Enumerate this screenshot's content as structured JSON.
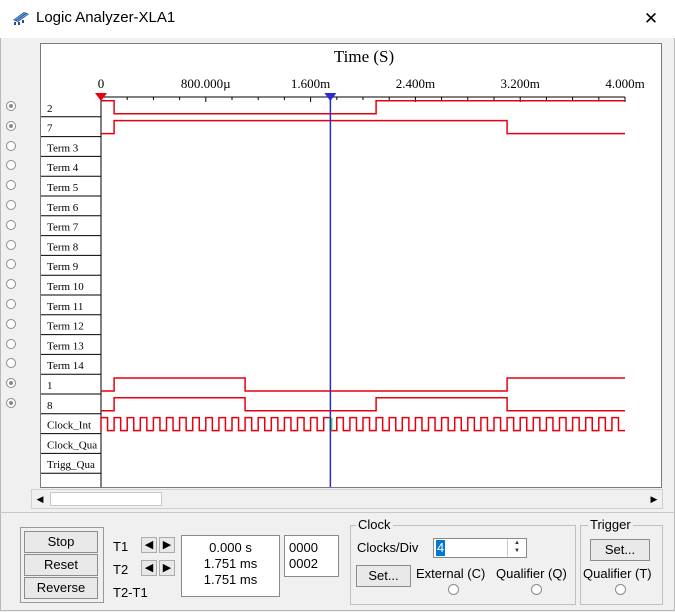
{
  "window": {
    "title": "Logic Analyzer-XLA1",
    "close_glyph": "✕",
    "icon": "logic-analyzer-icon"
  },
  "scope": {
    "axis_title": "Time (S)",
    "tick_labels": [
      "0",
      "800.000µ",
      "1.600m",
      "2.400m",
      "3.200m",
      "4.000m"
    ],
    "cursor_position_ms": 1.751,
    "colors": {
      "trace": "#e8000f",
      "cursor": "#2b2bd6",
      "trigger_marker": "#e8000f",
      "clock_highlight": "#39d631"
    },
    "channels": [
      {
        "label": "2",
        "connected": true
      },
      {
        "label": "7",
        "connected": true
      },
      {
        "label": "Term 3",
        "connected": false
      },
      {
        "label": "Term 4",
        "connected": false
      },
      {
        "label": "Term 5",
        "connected": false
      },
      {
        "label": "Term 6",
        "connected": false
      },
      {
        "label": "Term 7",
        "connected": false
      },
      {
        "label": "Term 8",
        "connected": false
      },
      {
        "label": "Term 9",
        "connected": false
      },
      {
        "label": "Term 10",
        "connected": false
      },
      {
        "label": "Term 11",
        "connected": false
      },
      {
        "label": "Term 12",
        "connected": false
      },
      {
        "label": "Term 13",
        "connected": false
      },
      {
        "label": "Term 14",
        "connected": false
      },
      {
        "label": "1",
        "connected": true
      },
      {
        "label": "8",
        "connected": true
      }
    ],
    "extra_rows": [
      "Clock_Int",
      "Clock_Qua",
      "Trigg_Qua"
    ],
    "signals": [
      {
        "name": "2",
        "initial": 1,
        "transitions_ms": [
          0.1,
          2.1
        ]
      },
      {
        "name": "7",
        "initial": 0,
        "transitions_ms": [
          0.1,
          3.1
        ]
      },
      {
        "name": "1",
        "initial": 0,
        "transitions_ms": [
          0.1,
          1.1,
          3.1
        ]
      },
      {
        "name": "8",
        "initial": 0,
        "transitions_ms": [
          0.1,
          1.1,
          2.1,
          3.1
        ]
      }
    ],
    "clock": {
      "period_ms": 0.1,
      "start_ms": 0.0,
      "end_ms": 4.0
    }
  },
  "controls": {
    "stop": "Stop",
    "reset": "Reset",
    "reverse": "Reverse",
    "t1_label": "T1",
    "t2_label": "T2",
    "t2t1_label": "T2-T1",
    "t1_time": "0.000 s",
    "t2_time": "1.751 ms",
    "dt_time": "1.751 ms",
    "t1_code": "0000",
    "t2_code": "0002",
    "arrow_left": "◀",
    "arrow_right": "▶"
  },
  "clock_panel": {
    "title": "Clock",
    "clocks_div_label": "Clocks/Div",
    "clocks_div_value": "4",
    "set_label": "Set...",
    "external_label": "External (C)",
    "qualifier_label": "Qualifier (Q)"
  },
  "trigger_panel": {
    "title": "Trigger",
    "set_label": "Set...",
    "qualifier_label": "Qualifier (T)"
  },
  "scrollbar": {
    "left": "◀",
    "right": "▶"
  }
}
